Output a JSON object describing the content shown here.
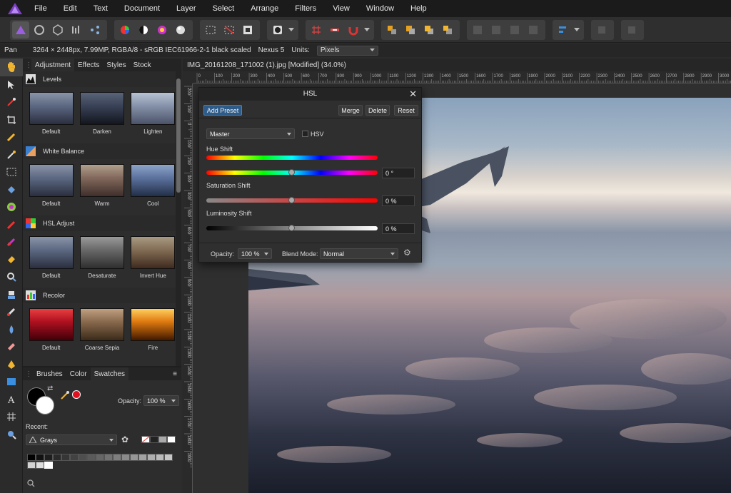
{
  "menu": {
    "items": [
      "File",
      "Edit",
      "Text",
      "Document",
      "Layer",
      "Select",
      "Arrange",
      "Filters",
      "View",
      "Window",
      "Help"
    ]
  },
  "toolbar": {
    "icons": [
      "persona-photo-icon",
      "persona-liquify-icon",
      "persona-develop-icon",
      "persona-tone-mapping-icon",
      "persona-export-icon",
      "color-wheel-icon",
      "contrast-icon",
      "color-balance-icon",
      "white-balance-icon",
      "marquee-icon",
      "no-selection-icon",
      "refine-selection-icon",
      "mask-icon",
      "grid-icon",
      "snapping-icon",
      "magnet-icon",
      "arrange-back-icon",
      "arrange-backward-icon",
      "arrange-forward-icon",
      "arrange-front-icon",
      "boolean-add-icon",
      "boolean-subtract-icon",
      "boolean-intersect-icon",
      "boolean-xor-icon",
      "align-icon",
      "flip-icon",
      "transform-icon"
    ]
  },
  "context": {
    "tool": "Pan",
    "info": "3264 × 2448px, 7.99MP, RGBA/8 - sRGB IEC61966-2-1 black scaled",
    "device": "Nexus 5",
    "units_label": "Units:",
    "units_value": "Pixels"
  },
  "tools": [
    "hand-icon",
    "move-icon",
    "eyedropper-icon",
    "crop-icon",
    "selection-brush-icon",
    "magic-wand-icon",
    "marquee-tool-icon",
    "flood-fill-icon",
    "gradient-icon",
    "paint-brush-icon",
    "color-replace-icon",
    "erase-brush-icon",
    "dodge-icon",
    "clone-icon",
    "blemish-icon",
    "blur-icon",
    "healing-icon",
    "pen-icon",
    "rectangle-icon",
    "text-icon",
    "mesh-warp-icon",
    "zoom-icon"
  ],
  "panel": {
    "tabs": [
      "Adjustment",
      "Effects",
      "Styles",
      "Stock"
    ],
    "sections": [
      {
        "title": "Levels",
        "presets": [
          "Default",
          "Darken",
          "Lighten"
        ]
      },
      {
        "title": "White Balance",
        "presets": [
          "Default",
          "Warm",
          "Cool"
        ]
      },
      {
        "title": "HSL Adjust",
        "presets": [
          "Default",
          "Desaturate",
          "Invert Hue"
        ]
      },
      {
        "title": "Recolor",
        "presets": [
          "Default",
          "Coarse Sepia",
          "Fire"
        ]
      }
    ]
  },
  "panel2": {
    "tabs": [
      "Brushes",
      "Color",
      "Swatches"
    ],
    "opacity_label": "Opacity:",
    "opacity_value": "100 %",
    "recent_label": "Recent:",
    "palette_value": "Grays"
  },
  "document": {
    "title": "IMG_20161208_171002 (1).jpg [Modified] (34.0%)"
  },
  "ruler": {
    "top": [
      "0",
      "100",
      "200",
      "300",
      "400",
      "500",
      "600",
      "700",
      "800",
      "900",
      "1000",
      "1100",
      "1200",
      "1300",
      "1400",
      "1500",
      "1600",
      "1700",
      "1800",
      "1900",
      "2000",
      "2100",
      "2200",
      "2300",
      "2400",
      "2500",
      "2600",
      "2700",
      "2800",
      "2900",
      "3000"
    ],
    "left": [
      "200",
      "100",
      "0",
      "100",
      "200",
      "300",
      "400",
      "500",
      "600",
      "700",
      "800",
      "900",
      "1000",
      "1100",
      "1200",
      "1300",
      "1400",
      "1500",
      "1600",
      "1700",
      "1800",
      "1900"
    ]
  },
  "hsl": {
    "title": "HSL",
    "add_preset": "Add Preset",
    "merge": "Merge",
    "delete": "Delete",
    "reset": "Reset",
    "channel": "Master",
    "hsv_label": "HSV",
    "hue_label": "Hue Shift",
    "hue_value": "0 °",
    "sat_label": "Saturation Shift",
    "sat_value": "0 %",
    "lum_label": "Luminosity Shift",
    "lum_value": "0 %",
    "opacity_label": "Opacity:",
    "opacity_value": "100 %",
    "blend_label": "Blend Mode:",
    "blend_value": "Normal",
    "hue_level": 0.5,
    "sat_level": 0.5,
    "lum_level": 0.5
  }
}
